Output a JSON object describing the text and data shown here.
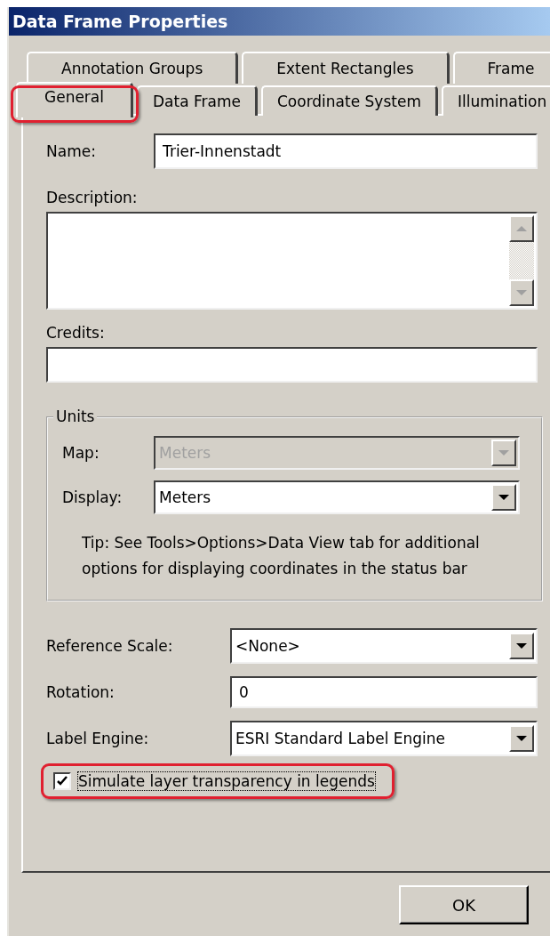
{
  "window": {
    "title": "Data Frame Properties"
  },
  "tab_rows": [
    [
      {
        "label": "Annotation Groups",
        "selected": false,
        "highlighted": false
      },
      {
        "label": "Extent Rectangles",
        "selected": false,
        "highlighted": false
      },
      {
        "label": "Frame",
        "selected": false,
        "highlighted": false
      }
    ],
    [
      {
        "label": "General",
        "selected": true,
        "highlighted": true
      },
      {
        "label": "Data Frame",
        "selected": false,
        "highlighted": false
      },
      {
        "label": "Coordinate System",
        "selected": false,
        "highlighted": false
      },
      {
        "label": "Illumination",
        "selected": false,
        "highlighted": false
      }
    ]
  ],
  "fields": [
    {
      "kind": "inline",
      "label": "Name:",
      "value": "Trier-Innenstadt"
    },
    {
      "kind": "textarea",
      "label": "Description:"
    },
    {
      "kind": "stacked",
      "label": "Credits:"
    }
  ],
  "units": {
    "title": "Units",
    "fields": [
      {
        "label": "Map:",
        "value": "Meters",
        "disabled": true
      },
      {
        "label": "Display:",
        "value": "Meters",
        "disabled": false
      }
    ],
    "tip": "Tip: See Tools>Options>Data View tab for additional options for displaying coordinates in the status bar"
  },
  "settings": [
    {
      "kind": "dropdown",
      "label": "Reference Scale:",
      "value": "<None>"
    },
    {
      "kind": "text",
      "label": "Rotation:",
      "value": "0"
    },
    {
      "kind": "dropdown",
      "label": "Label Engine:",
      "value": "ESRI Standard Label Engine"
    }
  ],
  "checkbox": {
    "label": "Simulate layer transparency in legends",
    "checked": true,
    "highlighted": true
  },
  "buttons": [
    {
      "label": "OK"
    }
  ]
}
